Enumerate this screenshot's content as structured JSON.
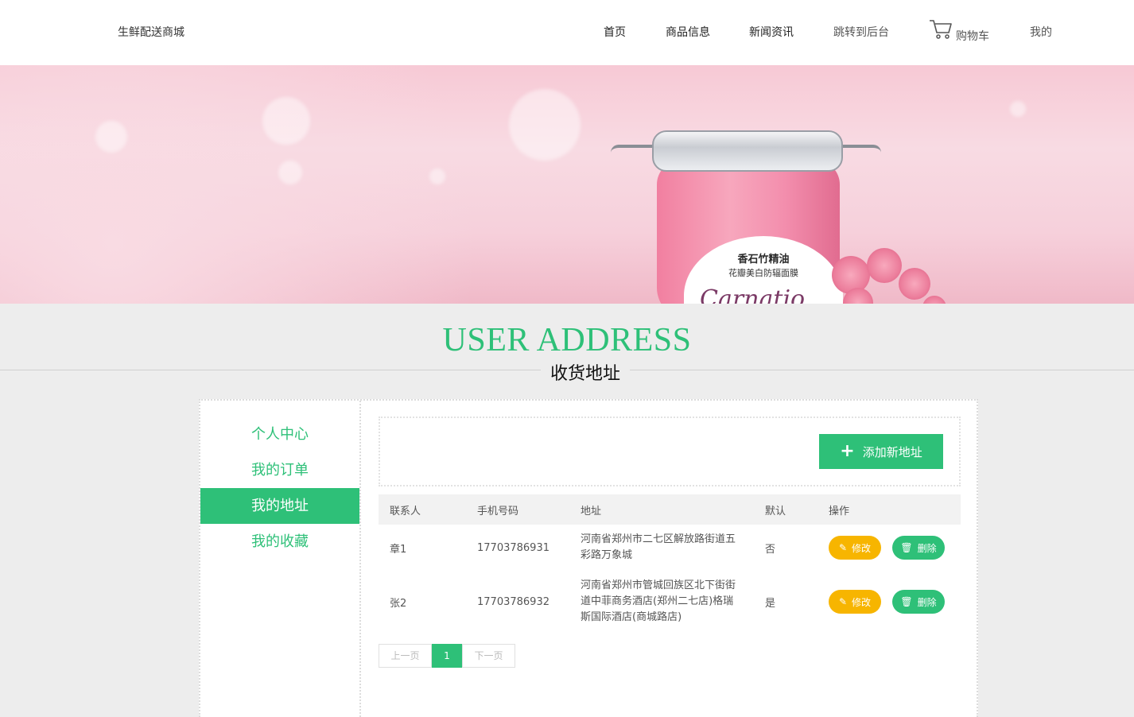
{
  "header": {
    "brand": "生鲜配送商城",
    "nav": [
      "首页",
      "商品信息",
      "新闻资讯",
      "跳转到后台"
    ],
    "cart_label": "购物车",
    "mine_label": "我的"
  },
  "banner": {
    "label_title": "香石竹精油",
    "label_subtitle": "花瓣美白防辐面膜",
    "label_script": "Carnatio"
  },
  "section": {
    "title_en": "USER ADDRESS",
    "title_cn": "收货地址"
  },
  "sidebar": {
    "items": [
      "个人中心",
      "我的订单",
      "我的地址",
      "我的收藏"
    ],
    "active": "我的地址"
  },
  "toolbar": {
    "add_label": "添加新地址"
  },
  "table": {
    "headers": [
      "联系人",
      "手机号码",
      "地址",
      "默认",
      "操作"
    ],
    "rows": [
      {
        "name": "章1",
        "phone": "17703786931",
        "address": "河南省郑州市二七区解放路街道五彩路万象城",
        "default": "否"
      },
      {
        "name": "张2",
        "phone": "17703786932",
        "address": "河南省郑州市管城回族区北下街街道中菲商务酒店(郑州二七店)格瑞斯国际酒店(商城路店)",
        "default": "是"
      }
    ],
    "edit_label": "修改",
    "delete_label": "删除"
  },
  "pagination": {
    "prev": "上一页",
    "current": "1",
    "next": "下一页"
  },
  "colors": {
    "accent": "#2ec078",
    "edit": "#f7b500"
  }
}
